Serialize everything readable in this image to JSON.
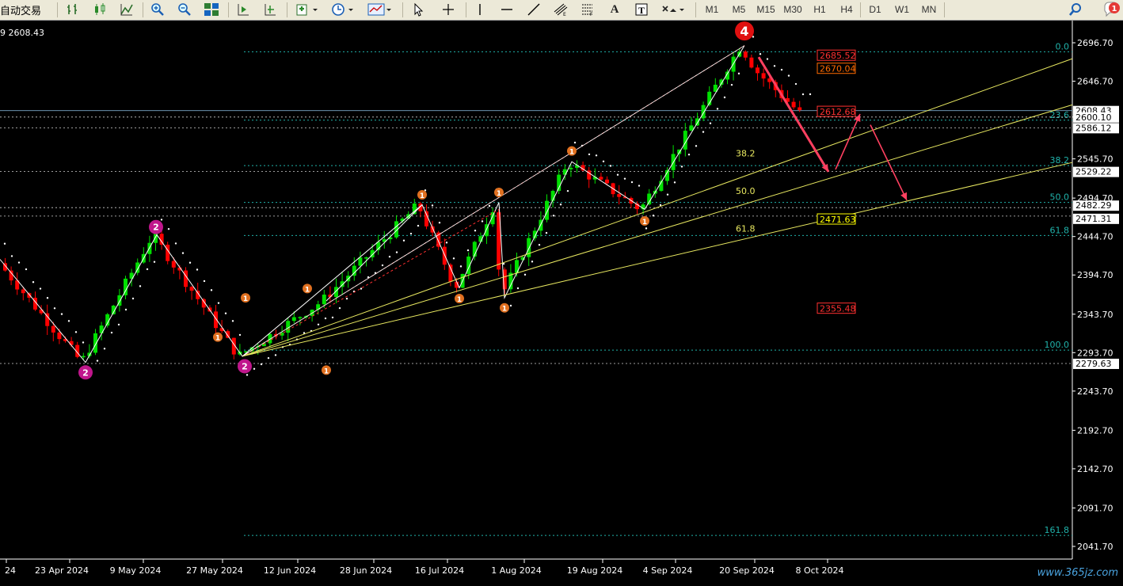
{
  "toolbar": {
    "auto_trade_label": "自动交易",
    "timeframes": [
      "M1",
      "M5",
      "M15",
      "M30",
      "H1",
      "H4",
      "D1",
      "W1",
      "MN"
    ],
    "text_tool": "A",
    "label_tool": "T",
    "notification_count": "1"
  },
  "chart": {
    "current_price_label": "9 2608.43",
    "price_axis_ticks": [
      "2696.70",
      "2646.70",
      "2600.10",
      "2545.70",
      "2494.70",
      "2444.70",
      "2394.70",
      "2343.70",
      "2293.70",
      "2243.70",
      "2192.70",
      "2142.70",
      "2091.70",
      "2041.70"
    ],
    "price_axis_markers": [
      {
        "text": "2608.43",
        "bg": "#FFFFFF",
        "fg": "#000000"
      },
      {
        "text": "2600.10",
        "bg": "#FFFFFF",
        "fg": "#000000"
      },
      {
        "text": "2586.12",
        "bg": "#FFFFFF",
        "fg": "#000000"
      },
      {
        "text": "2529.22",
        "bg": "#FFFFFF",
        "fg": "#000000"
      },
      {
        "text": "2482.29",
        "bg": "#FFFFFF",
        "fg": "#000000"
      },
      {
        "text": "2471.31",
        "bg": "#FFFFFF",
        "fg": "#000000"
      },
      {
        "text": "2279.63",
        "bg": "#FFFFFF",
        "fg": "#000000"
      }
    ],
    "date_axis": [
      "24",
      "23 Apr 2024",
      "9 May 2024",
      "27 May 2024",
      "12 Jun 2024",
      "28 Jun 2024",
      "16 Jul 2024",
      "1 Aug 2024",
      "19 Aug 2024",
      "4 Sep 2024",
      "20 Sep 2024",
      "8 Oct 2024"
    ],
    "fib_levels": [
      {
        "label": "0.0",
        "price": 2685
      },
      {
        "label": "23.6",
        "price": 2596
      },
      {
        "label": "38.2",
        "price": 2537
      },
      {
        "label": "50.0",
        "price": 2489
      },
      {
        "label": "61.8",
        "price": 2446
      },
      {
        "label": "100.0",
        "price": 2297
      },
      {
        "label": "161.8",
        "price": 2056
      }
    ],
    "fan_labels": [
      "38.2",
      "50.0",
      "61.8"
    ],
    "boxed_labels": [
      {
        "text": "2685.52",
        "color": "#FF3030"
      },
      {
        "text": "2670.04",
        "color": "#FF6A00"
      },
      {
        "text": "2612.68",
        "color": "#FF3030"
      },
      {
        "text": "2471.63",
        "color": "#FFFF00"
      },
      {
        "text": "2355.48",
        "color": "#FF3030"
      }
    ],
    "wave_marks": [
      {
        "text": "2",
        "color": "#C0168C"
      },
      {
        "text": "2",
        "color": "#C0168C"
      },
      {
        "text": "2",
        "color": "#C0168C"
      },
      {
        "text": "4",
        "color": "#E01010"
      }
    ],
    "swing_mark": "1",
    "watermark": "www.365jz.com",
    "colors": {
      "bull": "#00E000",
      "bear": "#FF0000",
      "fib": "#20B2AA",
      "axis": "#FFFFFF"
    }
  }
}
